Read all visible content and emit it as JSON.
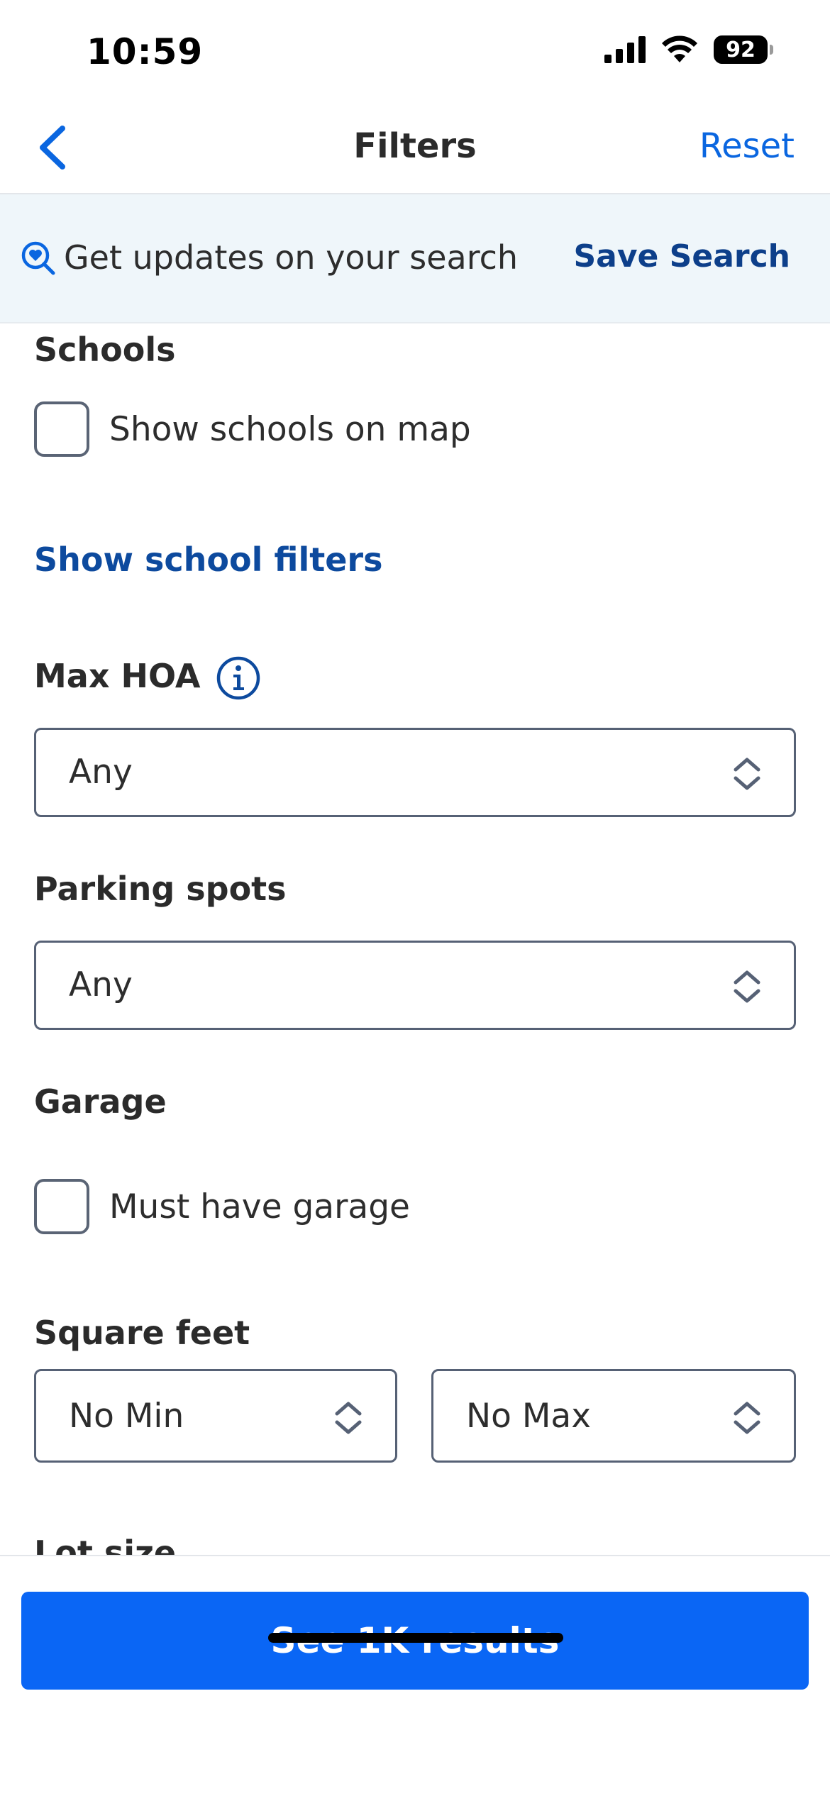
{
  "status_bar": {
    "time": "10:59",
    "battery": "92"
  },
  "header": {
    "title": "Filters",
    "reset_label": "Reset",
    "back_icon": "chevron-left-icon"
  },
  "save_banner": {
    "text": "Get updates on your search",
    "button_label": "Save Search",
    "icon": "search-heart-icon"
  },
  "schools": {
    "heading": "Schools",
    "checkbox_label": "Show schools on map",
    "checked": false,
    "filters_link": "Show school filters"
  },
  "max_hoa": {
    "heading": "Max HOA",
    "value": "Any",
    "icon": "info-icon"
  },
  "parking": {
    "heading": "Parking spots",
    "value": "Any"
  },
  "garage": {
    "heading": "Garage",
    "checkbox_label": "Must have garage",
    "checked": false
  },
  "square_feet": {
    "heading": "Square feet",
    "min_value": "No Min",
    "max_value": "No Max"
  },
  "lot_size": {
    "heading": "Lot size"
  },
  "footer": {
    "results_button": "See 1K results"
  },
  "colors": {
    "accent": "#0a66f5",
    "link": "#0d4a9e",
    "banner_bg": "#eff6fa"
  }
}
